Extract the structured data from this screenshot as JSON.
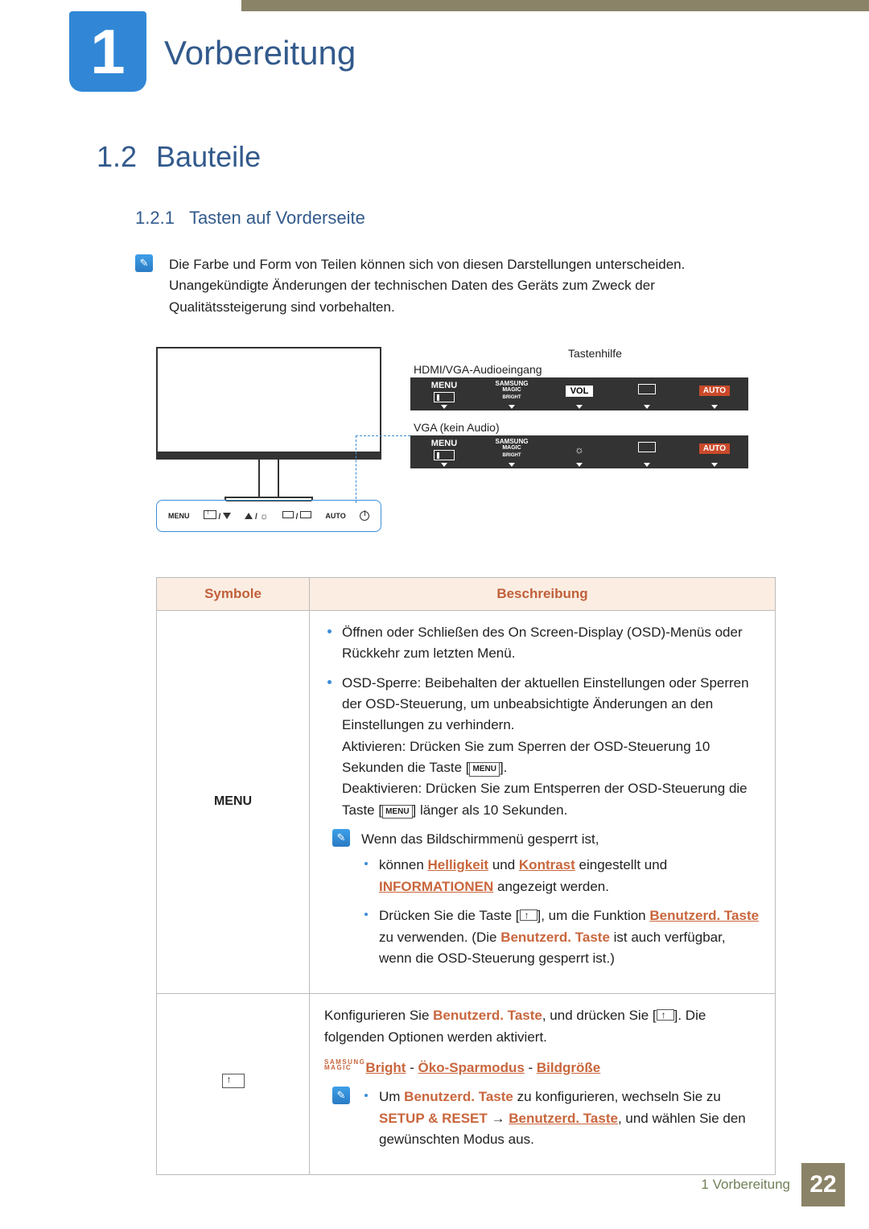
{
  "chapter": {
    "number": "1",
    "title": "Vorbereitung"
  },
  "section": {
    "number": "1.2",
    "title": "Bauteile"
  },
  "subsection": {
    "number": "1.2.1",
    "title": "Tasten auf Vorderseite"
  },
  "intro_note": "Die Farbe und Form von Teilen können sich von diesen Darstellungen unterscheiden. Unangekündigte Änderungen der technischen Daten des Geräts zum Zweck der Qualitätssteigerung sind vorbehalten.",
  "diagram": {
    "label_tastenhilfe": "Tastenhilfe",
    "label_hdmi": "HDMI/VGA-Audioeingang",
    "label_vga": "VGA (kein Audio)",
    "osd_menu": "MENU",
    "osd_samsung": "SAMSUNG",
    "osd_magic": "MAGIC",
    "osd_bright": "BRIGHT",
    "osd_vol": "VOL",
    "osd_auto": "AUTO",
    "btn_menu": "MENU",
    "btn_auto": "AUTO"
  },
  "table": {
    "col_symbole": "Symbole",
    "col_beschreibung": "Beschreibung",
    "row1": {
      "symbol": "MENU",
      "li1": "Öffnen oder Schließen des On Screen-Display (OSD)-Menüs oder Rückkehr zum letzten Menü.",
      "li2a": "OSD-Sperre: Beibehalten der aktuellen Einstellungen oder Sperren der OSD-Steuerung, um unbeabsichtigte Änderungen an den Einstellungen zu verhindern.",
      "li2b_pre": "Aktivieren: Drücken Sie zum Sperren der OSD-Steuerung 10 Sekunden die Taste [",
      "li2b_post": "].",
      "li2c_pre": "Deaktivieren: Drücken Sie zum Entsperren der OSD-Steuerung die Taste [",
      "li2c_post": "] länger als 10 Sekunden.",
      "note_lead": "Wenn das Bildschirmmenü gesperrt ist,",
      "note_li1_pre": "können ",
      "note_li1_link1": "Helligkeit",
      "note_li1_mid1": " und ",
      "note_li1_link2": "Kontrast",
      "note_li1_mid2": " eingestellt und ",
      "note_li1_link3": "INFORMATIONEN",
      "note_li1_post": " angezeigt werden.",
      "note_li2_pre": "Drücken Sie die Taste [",
      "note_li2_mid1": "], um die Funktion ",
      "note_li2_link": "Benutzerd. Taste",
      "note_li2_mid2": " zu verwenden. (Die ",
      "note_li2_bold": "Benutzerd. Taste",
      "note_li2_post": " ist auch verfügbar, wenn die OSD-Steuerung gesperrt ist.)"
    },
    "row2": {
      "p1_pre": "Konfigurieren Sie ",
      "p1_bold": "Benutzerd. Taste",
      "p1_mid": ", und drücken Sie [",
      "p1_post": "]. Die folgenden Optionen werden aktiviert.",
      "links_bright": "Bright",
      "links_eco": "Öko-Sparmodus",
      "links_size": "Bildgröße",
      "dash": " - ",
      "magic_samsung": "SAMSUNG",
      "magic_magic": "MAGIC",
      "note_li_pre": "Um ",
      "note_li_bold1": "Benutzerd. Taste",
      "note_li_mid1": " zu konfigurieren, wechseln Sie zu ",
      "note_li_setup": "SETUP & RESET",
      "note_li_arrow": " → ",
      "note_li_link": "Benutzerd. Taste",
      "note_li_post": ", und wählen Sie den gewünschten Modus aus."
    }
  },
  "footer": {
    "text": "1 Vorbereitung",
    "page": "22"
  }
}
